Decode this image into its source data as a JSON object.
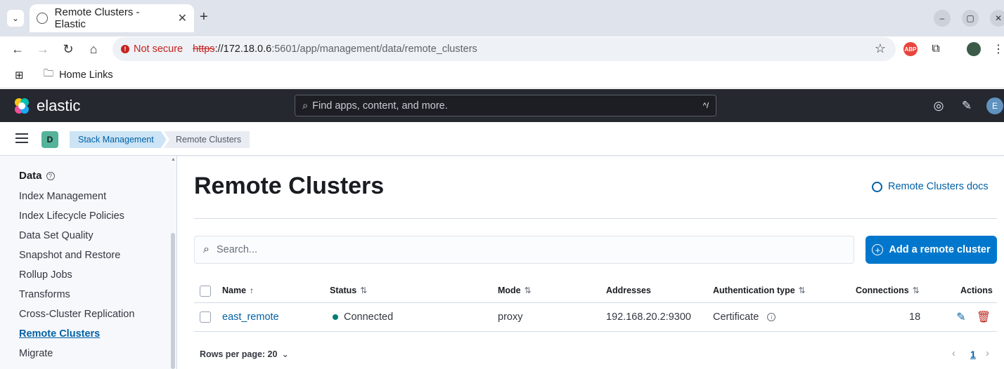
{
  "browser": {
    "tab_title": "Remote Clusters - Elastic",
    "security_label": "Not secure",
    "url_scheme": "https",
    "url_host": "://172.18.0.6",
    "url_path": ":5601/app/management/data/remote_clusters",
    "bookmark_folder": "Home Links",
    "extension_abp": "ABP"
  },
  "kibana": {
    "logo_text": "elastic",
    "search_placeholder": "Find apps, content, and more.",
    "search_shortcut": "^/",
    "avatar_initial": "E",
    "space_initial": "D"
  },
  "breadcrumbs": {
    "parent": "Stack Management",
    "current": "Remote Clusters"
  },
  "sidebar": {
    "section_title": "Data",
    "items": [
      {
        "label": "Index Management"
      },
      {
        "label": "Index Lifecycle Policies"
      },
      {
        "label": "Data Set Quality"
      },
      {
        "label": "Snapshot and Restore"
      },
      {
        "label": "Rollup Jobs"
      },
      {
        "label": "Transforms"
      },
      {
        "label": "Cross-Cluster Replication"
      },
      {
        "label": "Remote Clusters",
        "active": true
      },
      {
        "label": "Migrate"
      }
    ]
  },
  "main": {
    "title": "Remote Clusters",
    "docs_link": "Remote Clusters docs",
    "search_placeholder": "Search...",
    "add_button": "Add a remote cluster",
    "columns": {
      "name": "Name",
      "status": "Status",
      "mode": "Mode",
      "addresses": "Addresses",
      "auth": "Authentication type",
      "connections": "Connections",
      "actions": "Actions"
    },
    "rows": [
      {
        "name": "east_remote",
        "status": "Connected",
        "mode": "proxy",
        "addresses": "192.168.20.2:9300",
        "auth": "Certificate",
        "connections": "18"
      }
    ],
    "rows_per_page": "Rows per page: 20",
    "current_page": "1"
  },
  "colors": {
    "accent": "#0077cc",
    "link": "#0061a6",
    "status_connected": "#017d73",
    "header_bg": "#25282f",
    "danger": "#bd271e"
  }
}
